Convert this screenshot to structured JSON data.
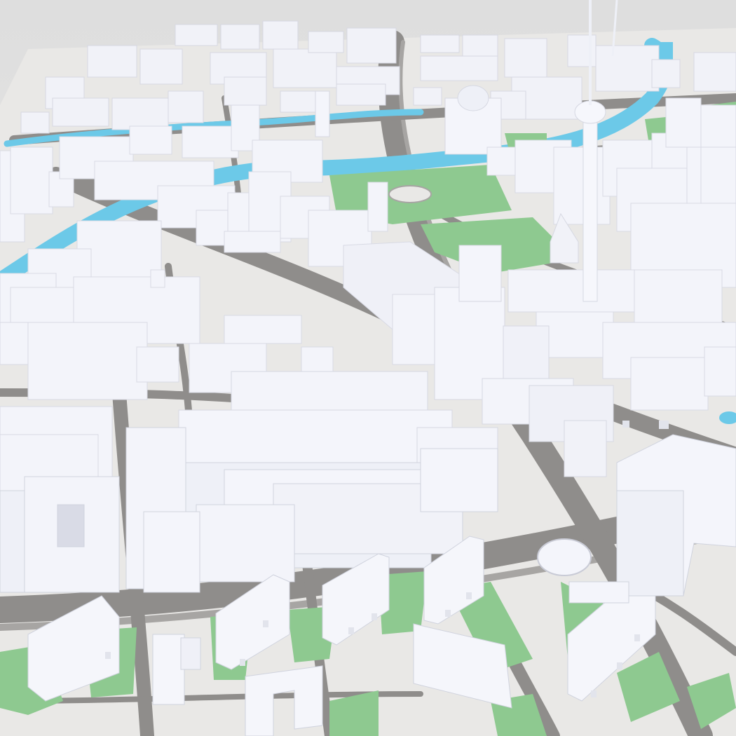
{
  "scene": {
    "subject": "3d-city-model-render",
    "colors": {
      "sky": "#e3e3e3",
      "ground": "#e9e8e6",
      "road": "#8f8d8b",
      "road_light": "#a7a5a3",
      "water": "#6cc9e8",
      "park": "#8ec990",
      "building_top": "#f4f5fb",
      "building_side": "#dfe1ea",
      "building_shadow": "#c9cbd6"
    },
    "icons": {
      "tv-tower": "tower-icon",
      "river": "river-icon",
      "park": "park-icon"
    }
  }
}
